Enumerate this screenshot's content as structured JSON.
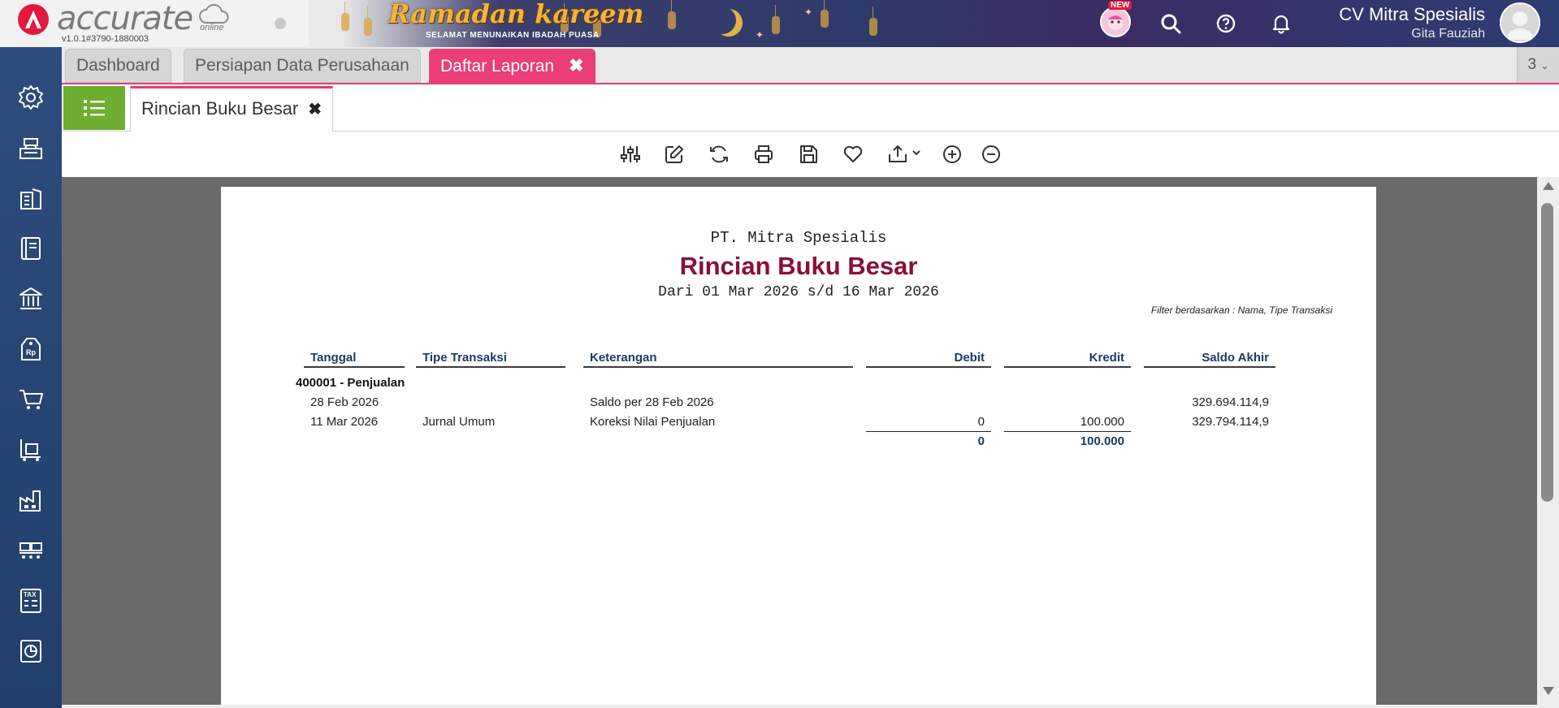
{
  "header": {
    "logo_text": "accurate",
    "logo_suffix": "online",
    "version": "v1.0.1#3790-1880003",
    "banner_title": "Ramadan kareem",
    "banner_subtitle": "SELAMAT MENUNAIKAN IBADAH PUASA",
    "new_badge": "NEW",
    "company": "CV Mitra Spesialis",
    "user": "Gita Fauziah",
    "colors": {
      "accent": "#ea3e79",
      "brand_red": "#e4173e",
      "sidebar": "#2d4d7c"
    }
  },
  "sidebar": {
    "items": [
      {
        "icon": "gear-icon"
      },
      {
        "icon": "cash-register-icon"
      },
      {
        "icon": "building-icon"
      },
      {
        "icon": "ledger-book-icon"
      },
      {
        "icon": "bank-icon"
      },
      {
        "icon": "price-tag-icon"
      },
      {
        "icon": "shopping-cart-icon"
      },
      {
        "icon": "trolley-icon"
      },
      {
        "icon": "factory-icon"
      },
      {
        "icon": "inventory-icon"
      },
      {
        "icon": "tax-icon"
      },
      {
        "icon": "report-chart-icon"
      }
    ]
  },
  "tabs": [
    {
      "label": "Dashboard",
      "active": false
    },
    {
      "label": "Persiapan Data Perusahaan",
      "active": false
    },
    {
      "label": "Daftar Laporan",
      "active": true,
      "close": "✖"
    }
  ],
  "tab_counter": "3",
  "subtab": {
    "label": "Rincian Buku Besar",
    "close": "✖"
  },
  "toolbar": {
    "items": [
      "filter-sliders-icon",
      "edit-icon",
      "refresh-icon",
      "print-icon",
      "save-icon",
      "favorite-heart-icon",
      "export-icon",
      "zoom-in-icon",
      "zoom-out-icon"
    ]
  },
  "report": {
    "company": "PT. Mitra Spesialis",
    "title": "Rincian Buku Besar",
    "period": "Dari 01 Mar 2026 s/d 16 Mar 2026",
    "filter_note": "Filter berdasarkan : Nama, Tipe Transaksi",
    "columns": {
      "tanggal": "Tanggal",
      "tipe": "Tipe Transaksi",
      "keterangan": "Keterangan",
      "debit": "Debit",
      "kredit": "Kredit",
      "saldo": "Saldo Akhir"
    },
    "group": "400001 - Penjualan",
    "rows": [
      {
        "tanggal": "28 Feb 2026",
        "tipe": "",
        "keterangan": "Saldo per 28 Feb 2026",
        "debit": "",
        "kredit": "",
        "saldo": "329.694.114,9"
      },
      {
        "tanggal": "11 Mar 2026",
        "tipe": "Jurnal Umum",
        "keterangan": "Koreksi Nilai Penjualan",
        "debit": "0",
        "kredit": "100.000",
        "saldo": "329.794.114,9"
      }
    ],
    "totals": {
      "debit": "0",
      "kredit": "100.000"
    }
  }
}
